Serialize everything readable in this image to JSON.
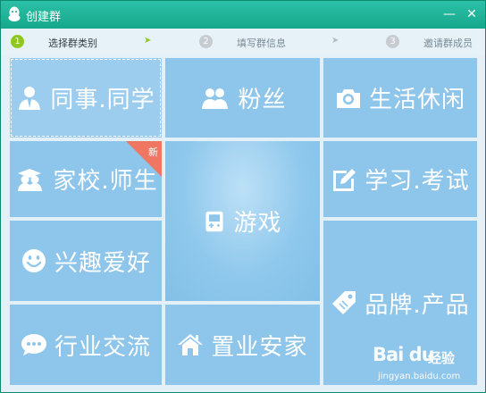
{
  "window": {
    "title": "创建群",
    "minimize_glyph": "—",
    "close_glyph": "✕"
  },
  "steps": [
    {
      "num": "1",
      "label": "选择群类别",
      "state": "active"
    },
    {
      "num": "2",
      "label": "填写群信息",
      "state": "inactive"
    },
    {
      "num": "3",
      "label": "邀请群成员",
      "state": "inactive"
    }
  ],
  "step_arrow_glyph": "➤",
  "tiles": {
    "colleagues": {
      "label": "同事.同学",
      "icon": "person-icon"
    },
    "fans": {
      "label": "粉丝",
      "icon": "two-people-icon"
    },
    "life": {
      "label": "生活休闲",
      "icon": "camera-icon"
    },
    "school": {
      "label": "家校.师生",
      "icon": "graduation-icon",
      "badge": "新"
    },
    "games": {
      "label": "游戏",
      "icon": "gamepad-icon"
    },
    "study": {
      "label": "学习.考试",
      "icon": "edit-icon"
    },
    "hobby": {
      "label": "兴趣爱好",
      "icon": "smiley-icon"
    },
    "brand": {
      "label": "品牌.产品",
      "icon": "tag-icon"
    },
    "industry": {
      "label": "行业交流",
      "icon": "chat-icon"
    },
    "property": {
      "label": "置业安家",
      "icon": "house-icon"
    }
  },
  "watermark": {
    "brand": "Bai du",
    "sub": "经验",
    "url": "jingyan.baidu.com"
  },
  "colors": {
    "titlebar": "#16a88d",
    "tile": "#8ec5ea",
    "step_active": "#8ec81f",
    "badge": "#ef7660"
  }
}
